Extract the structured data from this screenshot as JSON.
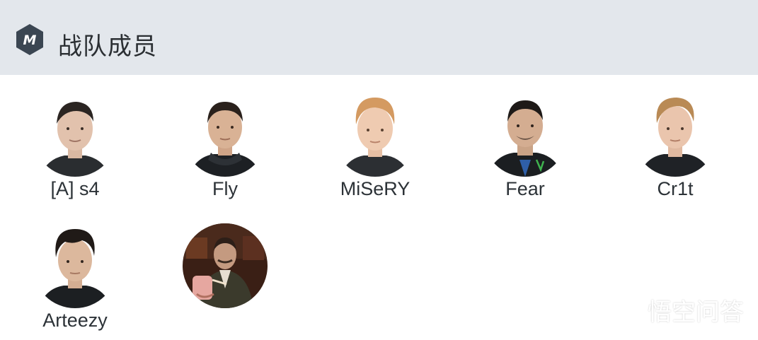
{
  "header": {
    "title": "战队成员",
    "logo_icon": "team-m-hexagon-icon"
  },
  "members": [
    {
      "name": "[A] s4"
    },
    {
      "name": "Fly"
    },
    {
      "name": "MiSeRY"
    },
    {
      "name": "Fear"
    },
    {
      "name": "Cr1t"
    },
    {
      "name": "Arteezy"
    },
    {
      "name": ""
    }
  ],
  "watermark": {
    "text": "悟空问答",
    "icon": "chat-bubbles-icon"
  },
  "colors": {
    "header_bg": "#e3e7ec",
    "title_text": "#2b2f33",
    "logo_bg": "#3b4652",
    "name_text": "#2c3237"
  }
}
